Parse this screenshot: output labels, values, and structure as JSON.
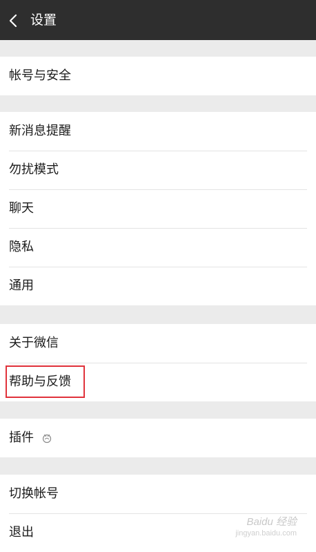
{
  "header": {
    "title": "设置"
  },
  "groups": [
    {
      "items": [
        {
          "label": "帐号与安全"
        }
      ]
    },
    {
      "items": [
        {
          "label": "新消息提醒"
        },
        {
          "label": "勿扰模式"
        },
        {
          "label": "聊天"
        },
        {
          "label": "隐私"
        },
        {
          "label": "通用"
        }
      ]
    },
    {
      "items": [
        {
          "label": "关于微信"
        },
        {
          "label": "帮助与反馈"
        }
      ]
    },
    {
      "items": [
        {
          "label": "插件"
        }
      ]
    },
    {
      "items": [
        {
          "label": "切换帐号"
        },
        {
          "label": "退出"
        }
      ]
    }
  ],
  "watermark": {
    "brand": "Baidu 经验",
    "url": "jingyan.baidu.com"
  },
  "colors": {
    "header_bg": "#2e2e2e",
    "background": "#ebebeb",
    "highlight": "#e0313a"
  }
}
